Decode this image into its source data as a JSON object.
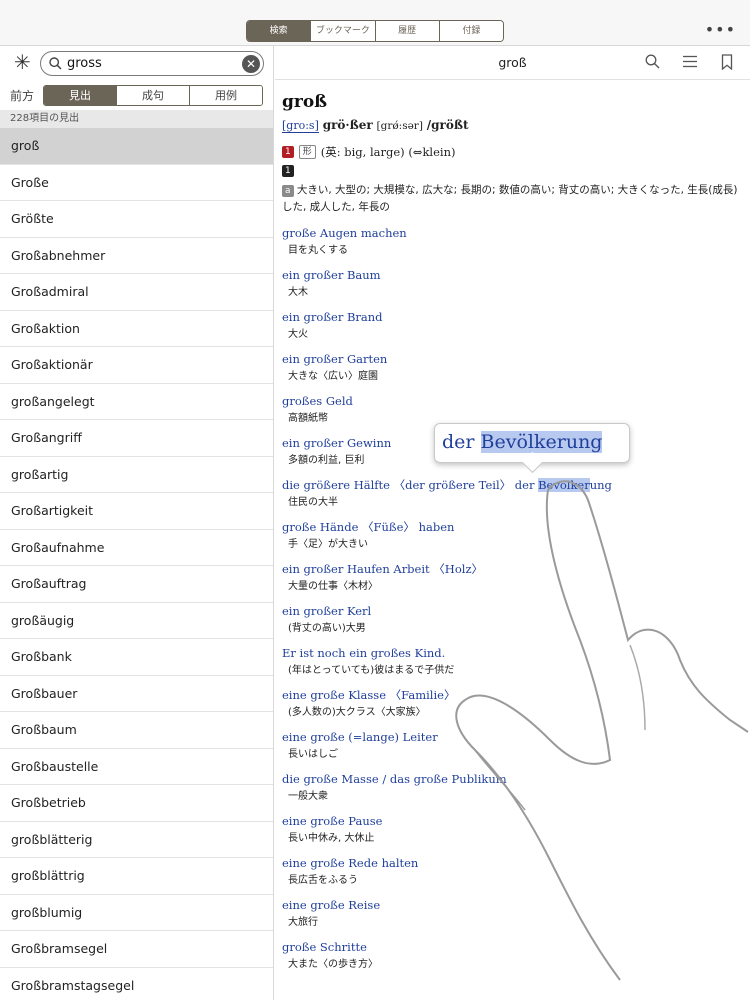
{
  "top_tabs": [
    "検索",
    "ブックマーク",
    "履歴",
    "付録"
  ],
  "more_icon": "more-dots-icon",
  "search": {
    "query": "gross"
  },
  "mode": {
    "label": "前方",
    "options": [
      "見出",
      "成句",
      "用例"
    ]
  },
  "result_count": "228項目の見出",
  "list": [
    "groß",
    "Große",
    "Größte",
    "Großabnehmer",
    "Großadmiral",
    "Großaktion",
    "Großaktionär",
    "großangelegt",
    "Großangriff",
    "großartig",
    "Großartigkeit",
    "Großaufnahme",
    "Großauftrag",
    "großäugig",
    "Großbank",
    "Großbauer",
    "Großbaum",
    "Großbaustelle",
    "Großbetrieb",
    "großblätterig",
    "großblättrig",
    "großblumig",
    "Großbramsegel",
    "Großbramstagsegel"
  ],
  "detail": {
    "header_title": "groß",
    "headword": "groß",
    "pron": "gro:s",
    "comparative": "grö·ßer",
    "comparative_pron": "[grǿ:sər]",
    "superlative": "/größt",
    "sense1_num": "1",
    "sense1_pos": "形",
    "sense1_text": "(英: big, large) (⇔klein)",
    "sub1_num": "1",
    "sub_a_tag": "a",
    "sub_a_def": "大きい, 大型の; 大規模な, 広大な; 長期の; 数値の高い; 背丈の高い; 大きくなった, 生長(成長)した, 成人した, 年長の",
    "examples": [
      {
        "de": "große Augen machen",
        "ja": "目を丸くする"
      },
      {
        "de": "ein großer Baum",
        "ja": "大木"
      },
      {
        "de": "ein großer Brand",
        "ja": "大火"
      },
      {
        "de": "ein großer Garten",
        "ja": "大きな〈広い〉庭園"
      },
      {
        "de": "großes Geld",
        "ja": "高額紙幣"
      },
      {
        "de": "ein großer Gewinn",
        "ja": "多額の利益, 巨利"
      },
      {
        "de_prefix": "die größere Hälfte 〈der größere Teil〉 der ",
        "de_hl": "Bevölker",
        "de_suffix": "ung",
        "ja": "住民の大半"
      },
      {
        "de": "große Hände 〈Füße〉 haben",
        "ja": "手〈足〉が大きい"
      },
      {
        "de": "ein großer Haufen Arbeit 〈Holz〉",
        "ja": "大量の仕事〈木材〉"
      },
      {
        "de": "ein großer Kerl",
        "ja": "(背丈の高い)大男"
      },
      {
        "de": "Er ist noch ein großes Kind.",
        "ja": "(年はとっていても)彼はまるで子供だ"
      },
      {
        "de": "eine große Klasse 〈Familie〉",
        "ja": "(多人数の)大クラス〈大家族〉"
      },
      {
        "de": "eine große (=lange) Leiter",
        "ja": "長いはしご"
      },
      {
        "de": "die große Masse / das große Publikum",
        "ja": "一般大衆"
      },
      {
        "de": "eine große Pause",
        "ja": "長い中休み, 大休止"
      },
      {
        "de": "eine große Rede halten",
        "ja": "長広舌をふるう"
      },
      {
        "de": "eine große Reise",
        "ja": "大旅行"
      },
      {
        "de": "große Schritte",
        "ja": "大また〈の歩き方〉"
      }
    ],
    "popup_prefix": "der ",
    "popup_hl": "Bevölkerung"
  }
}
